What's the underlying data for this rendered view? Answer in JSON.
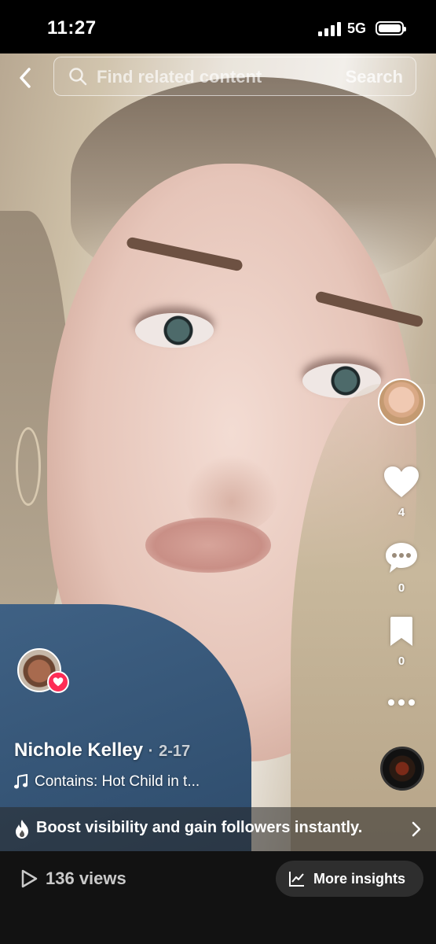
{
  "status_bar": {
    "time": "11:27",
    "network": "5G"
  },
  "search": {
    "placeholder": "Find related content",
    "button_label": "Search"
  },
  "actions": {
    "likes": "4",
    "comments": "0",
    "favorites": "0"
  },
  "video": {
    "author": "Nichole Kelley",
    "separator": "·",
    "date": "2-17",
    "music": "Contains: Hot Child in t..."
  },
  "promo": {
    "text": "Boost visibility and gain followers instantly."
  },
  "footer": {
    "views": "136 views",
    "insights_label": "More insights"
  },
  "colors": {
    "accent": "#fe2c55",
    "bottom_bar": "#121212",
    "insights_button": "#2e2e2e"
  },
  "icons": [
    "chevron-left-icon",
    "search-icon",
    "heart-icon",
    "comment-icon",
    "bookmark-icon",
    "more-icon",
    "music-note-icon",
    "flame-icon",
    "chevron-right-icon",
    "play-icon",
    "chart-icon"
  ]
}
